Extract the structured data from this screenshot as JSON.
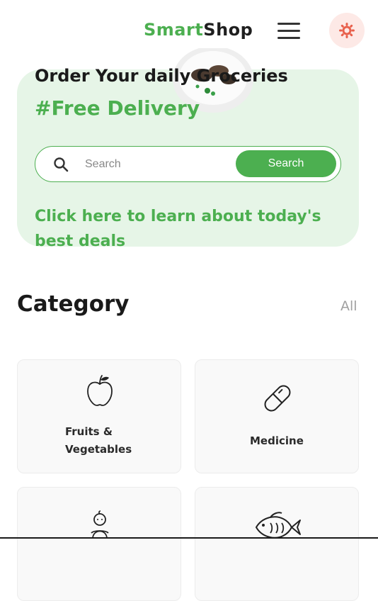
{
  "header": {
    "logo_part1": "Smart",
    "logo_part2": "Shop",
    "menu_icon": "hamburger-icon",
    "theme_icon": "sun-icon"
  },
  "hero": {
    "title": "Order Your daily Groceries",
    "subtitle": "#Free Delivery",
    "search_placeholder": "Search",
    "search_value": "",
    "search_button": "Search",
    "deals_link": "Click here to learn about today's best deals"
  },
  "category": {
    "title": "Category",
    "all_link": "All",
    "items": [
      {
        "label_line1": "Fruits &",
        "label_line2": "Vegetables",
        "icon": "apple-icon"
      },
      {
        "label_line1": "Medicine",
        "label_line2": "",
        "icon": "pill-icon"
      },
      {
        "label_line1": "",
        "label_line2": "",
        "icon": "baby-icon"
      },
      {
        "label_line1": "",
        "label_line2": "",
        "icon": "fish-icon"
      }
    ]
  },
  "colors": {
    "brand_green": "#4caf50",
    "hero_bg": "#e6f5e7",
    "theme_bg": "#fde9e6",
    "theme_icon": "#e8604c"
  }
}
